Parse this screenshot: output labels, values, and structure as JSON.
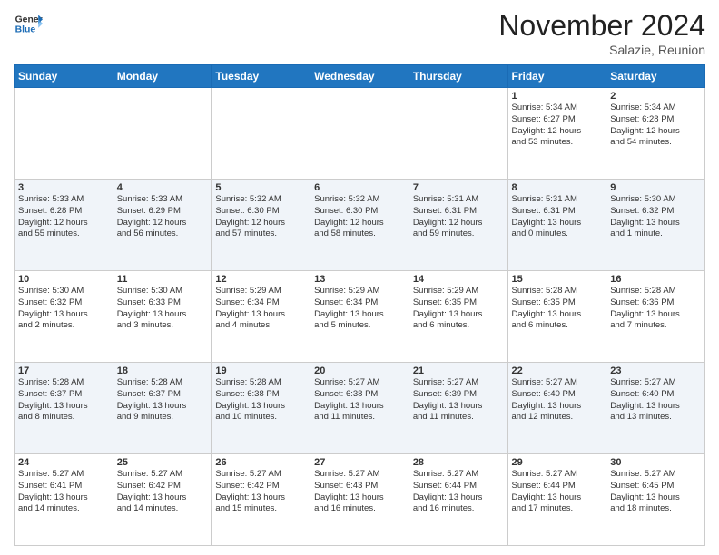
{
  "header": {
    "logo_line1": "General",
    "logo_line2": "Blue",
    "month": "November 2024",
    "location": "Salazie, Reunion"
  },
  "weekdays": [
    "Sunday",
    "Monday",
    "Tuesday",
    "Wednesday",
    "Thursday",
    "Friday",
    "Saturday"
  ],
  "weeks": [
    [
      {
        "day": "",
        "info": ""
      },
      {
        "day": "",
        "info": ""
      },
      {
        "day": "",
        "info": ""
      },
      {
        "day": "",
        "info": ""
      },
      {
        "day": "",
        "info": ""
      },
      {
        "day": "1",
        "info": "Sunrise: 5:34 AM\nSunset: 6:27 PM\nDaylight: 12 hours\nand 53 minutes."
      },
      {
        "day": "2",
        "info": "Sunrise: 5:34 AM\nSunset: 6:28 PM\nDaylight: 12 hours\nand 54 minutes."
      }
    ],
    [
      {
        "day": "3",
        "info": "Sunrise: 5:33 AM\nSunset: 6:28 PM\nDaylight: 12 hours\nand 55 minutes."
      },
      {
        "day": "4",
        "info": "Sunrise: 5:33 AM\nSunset: 6:29 PM\nDaylight: 12 hours\nand 56 minutes."
      },
      {
        "day": "5",
        "info": "Sunrise: 5:32 AM\nSunset: 6:30 PM\nDaylight: 12 hours\nand 57 minutes."
      },
      {
        "day": "6",
        "info": "Sunrise: 5:32 AM\nSunset: 6:30 PM\nDaylight: 12 hours\nand 58 minutes."
      },
      {
        "day": "7",
        "info": "Sunrise: 5:31 AM\nSunset: 6:31 PM\nDaylight: 12 hours\nand 59 minutes."
      },
      {
        "day": "8",
        "info": "Sunrise: 5:31 AM\nSunset: 6:31 PM\nDaylight: 13 hours\nand 0 minutes."
      },
      {
        "day": "9",
        "info": "Sunrise: 5:30 AM\nSunset: 6:32 PM\nDaylight: 13 hours\nand 1 minute."
      }
    ],
    [
      {
        "day": "10",
        "info": "Sunrise: 5:30 AM\nSunset: 6:32 PM\nDaylight: 13 hours\nand 2 minutes."
      },
      {
        "day": "11",
        "info": "Sunrise: 5:30 AM\nSunset: 6:33 PM\nDaylight: 13 hours\nand 3 minutes."
      },
      {
        "day": "12",
        "info": "Sunrise: 5:29 AM\nSunset: 6:34 PM\nDaylight: 13 hours\nand 4 minutes."
      },
      {
        "day": "13",
        "info": "Sunrise: 5:29 AM\nSunset: 6:34 PM\nDaylight: 13 hours\nand 5 minutes."
      },
      {
        "day": "14",
        "info": "Sunrise: 5:29 AM\nSunset: 6:35 PM\nDaylight: 13 hours\nand 6 minutes."
      },
      {
        "day": "15",
        "info": "Sunrise: 5:28 AM\nSunset: 6:35 PM\nDaylight: 13 hours\nand 6 minutes."
      },
      {
        "day": "16",
        "info": "Sunrise: 5:28 AM\nSunset: 6:36 PM\nDaylight: 13 hours\nand 7 minutes."
      }
    ],
    [
      {
        "day": "17",
        "info": "Sunrise: 5:28 AM\nSunset: 6:37 PM\nDaylight: 13 hours\nand 8 minutes."
      },
      {
        "day": "18",
        "info": "Sunrise: 5:28 AM\nSunset: 6:37 PM\nDaylight: 13 hours\nand 9 minutes."
      },
      {
        "day": "19",
        "info": "Sunrise: 5:28 AM\nSunset: 6:38 PM\nDaylight: 13 hours\nand 10 minutes."
      },
      {
        "day": "20",
        "info": "Sunrise: 5:27 AM\nSunset: 6:38 PM\nDaylight: 13 hours\nand 11 minutes."
      },
      {
        "day": "21",
        "info": "Sunrise: 5:27 AM\nSunset: 6:39 PM\nDaylight: 13 hours\nand 11 minutes."
      },
      {
        "day": "22",
        "info": "Sunrise: 5:27 AM\nSunset: 6:40 PM\nDaylight: 13 hours\nand 12 minutes."
      },
      {
        "day": "23",
        "info": "Sunrise: 5:27 AM\nSunset: 6:40 PM\nDaylight: 13 hours\nand 13 minutes."
      }
    ],
    [
      {
        "day": "24",
        "info": "Sunrise: 5:27 AM\nSunset: 6:41 PM\nDaylight: 13 hours\nand 14 minutes."
      },
      {
        "day": "25",
        "info": "Sunrise: 5:27 AM\nSunset: 6:42 PM\nDaylight: 13 hours\nand 14 minutes."
      },
      {
        "day": "26",
        "info": "Sunrise: 5:27 AM\nSunset: 6:42 PM\nDaylight: 13 hours\nand 15 minutes."
      },
      {
        "day": "27",
        "info": "Sunrise: 5:27 AM\nSunset: 6:43 PM\nDaylight: 13 hours\nand 16 minutes."
      },
      {
        "day": "28",
        "info": "Sunrise: 5:27 AM\nSunset: 6:44 PM\nDaylight: 13 hours\nand 16 minutes."
      },
      {
        "day": "29",
        "info": "Sunrise: 5:27 AM\nSunset: 6:44 PM\nDaylight: 13 hours\nand 17 minutes."
      },
      {
        "day": "30",
        "info": "Sunrise: 5:27 AM\nSunset: 6:45 PM\nDaylight: 13 hours\nand 18 minutes."
      }
    ]
  ]
}
